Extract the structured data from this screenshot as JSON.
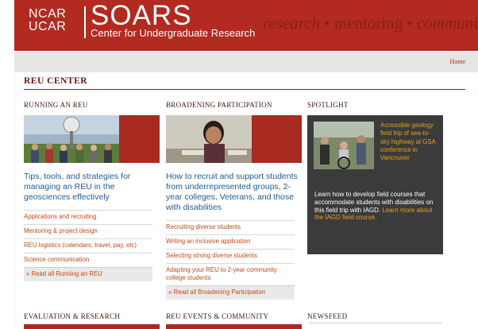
{
  "header": {
    "ncar_line1": "NCAR",
    "ncar_line2": "UCAR",
    "brand": "SOARS",
    "subtitle": "Center for Undergraduate Research",
    "tagline_1": "research",
    "tagline_sep1": " • ",
    "tagline_2": "mentoring",
    "tagline_sep2": " • ",
    "tagline_3": "community"
  },
  "nav": {
    "home": "Home"
  },
  "page_title": "REU CENTER",
  "columns": {
    "running": {
      "heading": "RUNNING AN REU",
      "blurb": "Tips, tools, and strategies for managing an REU in the geosciences effectively",
      "links": [
        "Applications and recruiting",
        "Mentoring & project design",
        "REU logistics (calendars, travel, pay, etc)",
        "Science communication"
      ],
      "read_all": "» Read all Running an REU"
    },
    "broadening": {
      "heading": "BROADENING PARTICIPATION",
      "blurb": "How to recruit and support students from underrepresented groups, 2-year colleges, Veterans, and those with disabilities",
      "links": [
        "Recruiting diverse students",
        "Writing an inclusive application",
        "Selecting strong diverse students",
        "Adapting your REU to 2-year community college students"
      ],
      "read_all": "» Read all Broadening Participation"
    },
    "spotlight": {
      "heading": "SPOTLIGHT",
      "caption": "Accessible geology field trip of sea-to-sky highway at GSA conference in Vancouver",
      "body_white": "Learn how to develop field courses that accommodate students with disabilities on this field trip with IAGD.",
      "body_orange": " Learn more about the IAGD field course."
    }
  },
  "bottom_headings": {
    "evaluation": "EVALUATION & RESEARCH",
    "events": "REU EVENTS & COMMUNITY",
    "newsfeed": "NEWSFEED"
  },
  "colors": {
    "brand_red": "#b22a20",
    "link_orange": "#c2491a",
    "blurb_blue": "#215c8e",
    "spotlight_bg": "#3b3b3b",
    "spotlight_orange": "#e8a015"
  }
}
